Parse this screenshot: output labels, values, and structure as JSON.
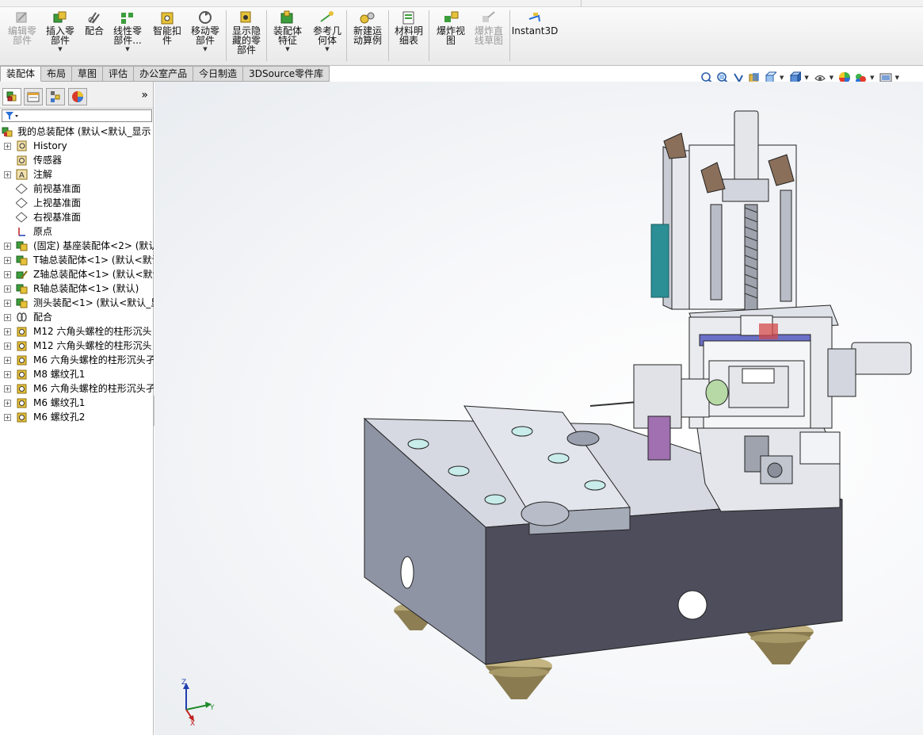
{
  "ribbon": {
    "buttons": [
      {
        "label": "编辑零\n部件",
        "disabled": true,
        "arrow": false
      },
      {
        "label": "插入零\n部件",
        "disabled": false,
        "arrow": true
      },
      {
        "label": "配合",
        "disabled": false,
        "arrow": false
      },
      {
        "label": "线性零\n部件...",
        "disabled": false,
        "arrow": true
      },
      {
        "label": "智能扣\n件",
        "disabled": false,
        "arrow": false
      },
      {
        "label": "移动零\n部件",
        "disabled": false,
        "arrow": true
      },
      {
        "label": "显示隐\n藏的零\n部件",
        "disabled": false,
        "arrow": false
      },
      {
        "label": "装配体\n特征",
        "disabled": false,
        "arrow": true
      },
      {
        "label": "参考几\n何体",
        "disabled": false,
        "arrow": true
      },
      {
        "label": "新建运\n动算例",
        "disabled": false,
        "arrow": false
      },
      {
        "label": "材料明\n细表",
        "disabled": false,
        "arrow": false
      },
      {
        "label": "爆炸视\n图",
        "disabled": false,
        "arrow": false
      },
      {
        "label": "爆炸直\n线草图",
        "disabled": true,
        "arrow": false
      },
      {
        "label": "Instant3D",
        "disabled": false,
        "arrow": false
      }
    ]
  },
  "tabs": [
    "装配体",
    "布局",
    "草图",
    "评估",
    "办公室产品",
    "今日制造",
    "3DSource零件库"
  ],
  "active_tab": "装配体",
  "panel": {
    "more_glyph": "»",
    "tree": [
      {
        "label": "我的总装配体 (默认<默认_显示",
        "icon": "assembly-icon",
        "root": true
      },
      {
        "label": "History",
        "icon": "history-icon",
        "expand": "+"
      },
      {
        "label": "传感器",
        "icon": "sensor-icon"
      },
      {
        "label": "注解",
        "icon": "annotation-icon",
        "expand": "+"
      },
      {
        "label": "前视基准面",
        "icon": "plane-icon"
      },
      {
        "label": "上视基准面",
        "icon": "plane-icon"
      },
      {
        "label": "右视基准面",
        "icon": "plane-icon"
      },
      {
        "label": "原点",
        "icon": "origin-icon"
      },
      {
        "label": "(固定) 基座装配体<2> (默认",
        "icon": "subassembly-icon",
        "expand": "+"
      },
      {
        "label": "T轴总装配体<1> (默认<默认",
        "icon": "subassembly-icon",
        "expand": "+"
      },
      {
        "label": "Z轴总装配体<1> (默认<默认",
        "icon": "subassembly-edit-icon",
        "expand": "+"
      },
      {
        "label": "R轴总装配体<1> (默认)",
        "icon": "subassembly-icon",
        "expand": "+"
      },
      {
        "label": "测头装配<1> (默认<默认_显",
        "icon": "subassembly-icon",
        "expand": "+"
      },
      {
        "label": "配合",
        "icon": "mates-icon",
        "expand": "+"
      },
      {
        "label": "M12 六角头螺栓的柱形沉头",
        "icon": "hole-icon",
        "expand": "+"
      },
      {
        "label": "M12 六角头螺栓的柱形沉头",
        "icon": "hole-icon",
        "expand": "+"
      },
      {
        "label": "M6 六角头螺栓的柱形沉头孑",
        "icon": "hole-icon",
        "expand": "+"
      },
      {
        "label": "M8 螺纹孔1",
        "icon": "hole-icon",
        "expand": "+"
      },
      {
        "label": "M6 六角头螺栓的柱形沉头孑",
        "icon": "hole-icon",
        "expand": "+"
      },
      {
        "label": "M6 螺纹孔1",
        "icon": "hole-icon",
        "expand": "+"
      },
      {
        "label": "M6 螺纹孔2",
        "icon": "hole-icon",
        "expand": "+"
      }
    ]
  },
  "triad": {
    "z": "Z",
    "y": "Y",
    "x": "X"
  },
  "colors": {
    "part_gray": "#8e94a4",
    "dark_face": "#4d4d5c",
    "light_face": "#d9dce3",
    "teal": "#2b8f95",
    "brass": "#b3a373"
  }
}
